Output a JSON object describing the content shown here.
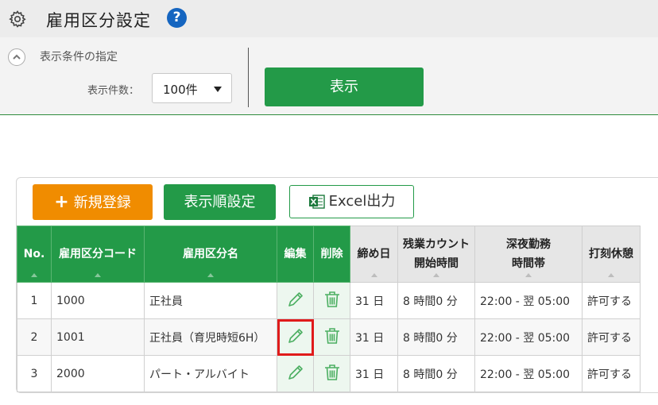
{
  "header": {
    "title": "雇用区分設定",
    "help_icon": "?"
  },
  "conditions": {
    "toggle_label": "表示条件の指定",
    "count_label": "表示件数：",
    "count_value": "100件",
    "show_button": "表示"
  },
  "toolbar": {
    "new_label": "新規登録",
    "order_label": "表示順設定",
    "excel_label": "Excel出力"
  },
  "table": {
    "headers": {
      "no": "No.",
      "code": "雇用区分コード",
      "name": "雇用区分名",
      "edit": "編集",
      "delete": "削除",
      "cutoff": "締め日",
      "overtime_1": "残業カウント",
      "overtime_2": "開始時間",
      "night_1": "深夜勤務",
      "night_2": "時間帯",
      "break": "打刻休憩"
    },
    "rows": [
      {
        "no": "1",
        "code": "1000",
        "name": "正社員",
        "cutoff": "31 日",
        "overtime": "8 時間0 分",
        "night": "22:00 - 翌 05:00",
        "break": "許可する"
      },
      {
        "no": "2",
        "code": "1001",
        "name": "正社員（育児時短6H）",
        "cutoff": "31 日",
        "overtime": "8 時間0 分",
        "night": "22:00 - 翌 05:00",
        "break": "許可する"
      },
      {
        "no": "3",
        "code": "2000",
        "name": "パート・アルバイト",
        "cutoff": "31 日",
        "overtime": "8 時間0 分",
        "night": "22:00 - 翌 05:00",
        "break": "許可する"
      }
    ]
  },
  "colors": {
    "accent_green": "#239a48",
    "orange": "#f08c00",
    "highlight_red": "#e01b1b",
    "help_blue": "#1565c0"
  }
}
